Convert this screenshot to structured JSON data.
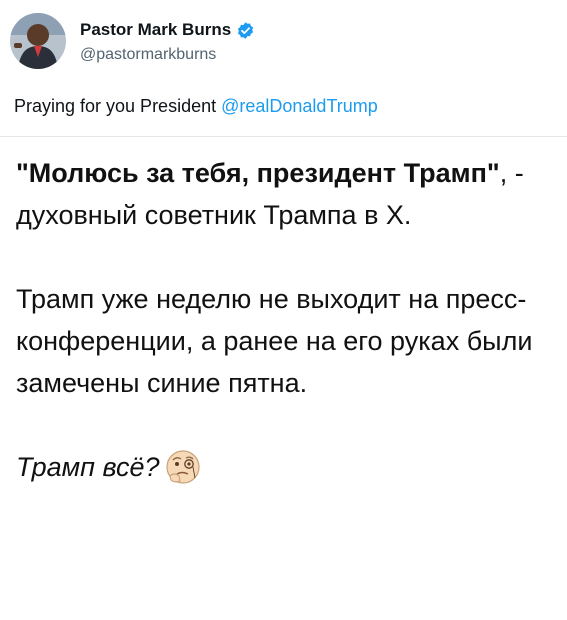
{
  "tweet": {
    "author_name": "Pastor Mark Burns",
    "handle": "@pastormarkburns",
    "text_prefix": "Praying for you President ",
    "mention": "@realDonaldTrump",
    "colors": {
      "verified": "#1d9bf0",
      "mention": "#1d9bf0"
    },
    "icons": {
      "verified": "verified-badge-icon",
      "avatar": "profile-photo"
    }
  },
  "post": {
    "quote": "\"Молюсь за тебя, президент Трамп\"",
    "quote_rest": ", - духовный советник Трампа в Х.",
    "paragraph2": "Трамп уже неделю не выходит на пресс-конференции, а ранее на его руках были замечены синие пятна.",
    "closing": "Трамп всё?",
    "closing_emoji": "thinking-face-with-monocle-icon"
  }
}
